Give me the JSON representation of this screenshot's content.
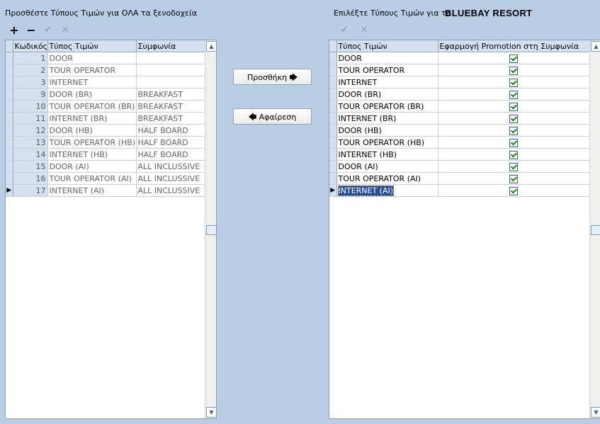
{
  "left": {
    "title": "Προσθέστε Τύπους Τιμών για ΟΛΑ τα ξενοδοχεία",
    "toolbar": {
      "add": "+",
      "remove": "−",
      "confirm": "✔",
      "cancel": "✕"
    },
    "columns": [
      "Κωδικός",
      "Τύπος Τιμών",
      "Συμφωνία"
    ],
    "rows": [
      {
        "code": "1",
        "type": "DOOR",
        "agreement": ""
      },
      {
        "code": "2",
        "type": "TOUR OPERATOR",
        "agreement": ""
      },
      {
        "code": "3",
        "type": "INTERNET",
        "agreement": ""
      },
      {
        "code": "9",
        "type": "DOOR (BR)",
        "agreement": "BREAKFAST"
      },
      {
        "code": "10",
        "type": "TOUR OPERATOR (BR)",
        "agreement": "BREAKFAST"
      },
      {
        "code": "11",
        "type": "INTERNET (BR)",
        "agreement": "BREAKFAST"
      },
      {
        "code": "12",
        "type": "DOOR (HB)",
        "agreement": "HALF BOARD"
      },
      {
        "code": "13",
        "type": "TOUR OPERATOR  (HB)",
        "agreement": "HALF BOARD"
      },
      {
        "code": "14",
        "type": "INTERNET  (HB)",
        "agreement": "HALF BOARD"
      },
      {
        "code": "15",
        "type": "DOOR (AI)",
        "agreement": "ALL INCLUSSIVE"
      },
      {
        "code": "16",
        "type": "TOUR OPERATOR  (AI)",
        "agreement": "ALL INCLUSSIVE"
      },
      {
        "code": "17",
        "type": "INTERNET  (AI)",
        "agreement": "ALL INCLUSSIVE"
      }
    ]
  },
  "middle": {
    "add_label": "Προσθήκη",
    "remove_label": "Αφαίρεση",
    "arrow_right": "🡆",
    "arrow_left": "🡄"
  },
  "right": {
    "title": "Επιλέξτε Τύπους Τιμών για το",
    "hotel": "BLUEBAY RESORT",
    "toolbar": {
      "confirm": "✔",
      "cancel": "✕"
    },
    "columns": [
      "Τύπος Τιμών",
      "Εφαρμογή Promotion στη Συμφωνία"
    ],
    "rows": [
      {
        "type": "DOOR",
        "promotion": true
      },
      {
        "type": "TOUR OPERATOR",
        "promotion": true
      },
      {
        "type": "INTERNET",
        "promotion": true
      },
      {
        "type": "DOOR (BR)",
        "promotion": true
      },
      {
        "type": "TOUR OPERATOR (BR)",
        "promotion": true
      },
      {
        "type": "INTERNET (BR)",
        "promotion": true
      },
      {
        "type": "DOOR (HB)",
        "promotion": true
      },
      {
        "type": "TOUR OPERATOR  (HB)",
        "promotion": true
      },
      {
        "type": "INTERNET  (HB)",
        "promotion": true
      },
      {
        "type": "DOOR (AI)",
        "promotion": true
      },
      {
        "type": "TOUR OPERATOR  (AI)",
        "promotion": true
      },
      {
        "type": "INTERNET  (AI)",
        "promotion": true
      }
    ]
  },
  "colors": {
    "background": "#b9cde5",
    "header": "#d4e0ef",
    "selection": "#2a4f9a",
    "check": "#1a8a1a"
  },
  "icons": {
    "current_row": "row-pointer-icon",
    "scroll_up": "chevron-up-icon",
    "scroll_down": "chevron-down-icon"
  }
}
